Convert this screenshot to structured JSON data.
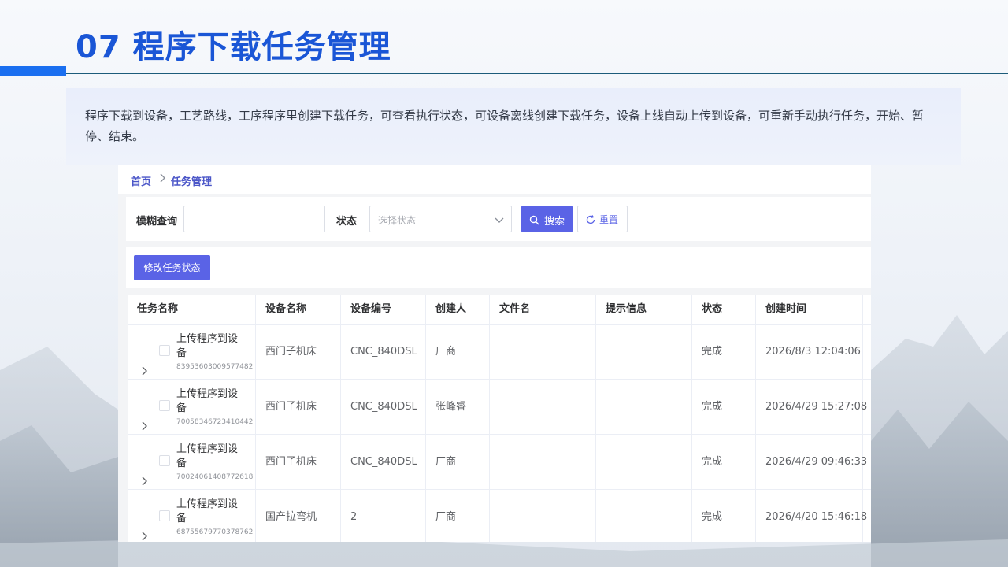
{
  "slide": {
    "title": "07 程序下载任务管理",
    "description": "程序下载到设备，工艺路线，工序程序里创建下载任务，可查看执行状态，可设备离线创建下载任务，设备上线自动上传到设备，可重新手动执行任务，开始、暂停、结束。"
  },
  "app": {
    "breadcrumb": {
      "home": "首页",
      "current": "任务管理"
    },
    "filters": {
      "keyword_label": "模糊查询",
      "keyword_value": "",
      "status_label": "状态",
      "status_placeholder": "选择状态",
      "search_label": "搜索",
      "reset_label": "重置"
    },
    "actions": {
      "modify_status_label": "修改任务状态"
    },
    "table": {
      "columns": [
        "任务名称",
        "设备名称",
        "设备编号",
        "创建人",
        "文件名",
        "提示信息",
        "状态",
        "创建时间"
      ],
      "rows": [
        {
          "task_name": "上传程序到设备",
          "task_id": "83953603009577482",
          "device_name": "西门子机床",
          "device_no": "CNC_840DSL",
          "creator": "厂商",
          "file_name": "",
          "message": "",
          "status": "完成",
          "created_at": "2026/8/3 12:04:06"
        },
        {
          "task_name": "上传程序到设备",
          "task_id": "70058346723410442",
          "device_name": "西门子机床",
          "device_no": "CNC_840DSL",
          "creator": "张峰睿",
          "file_name": "",
          "message": "",
          "status": "完成",
          "created_at": "2026/4/29 15:27:08"
        },
        {
          "task_name": "上传程序到设备",
          "task_id": "70024061408772618",
          "device_name": "西门子机床",
          "device_no": "CNC_840DSL",
          "creator": "厂商",
          "file_name": "",
          "message": "",
          "status": "完成",
          "created_at": "2026/4/29 09:46:33"
        },
        {
          "task_name": "上传程序到设备",
          "task_id": "68755679770378762",
          "device_name": "国产拉弯机",
          "device_no": "2",
          "creator": "厂商",
          "file_name": "",
          "message": "",
          "status": "完成",
          "created_at": "2026/4/20 15:46:18"
        }
      ]
    }
  },
  "icons": {
    "breadcrumb_separator": "chevron-right-icon",
    "select_arrow": "chevron-down-icon",
    "search_button": "search-icon",
    "reset_button": "refresh-icon",
    "row_expand": "chevron-right-icon"
  },
  "colors": {
    "title": "#1a56d6",
    "title_bar": "#1a6ff0",
    "primary_button": "#5a63e6",
    "breadcrumb_link": "#4b56c8"
  }
}
